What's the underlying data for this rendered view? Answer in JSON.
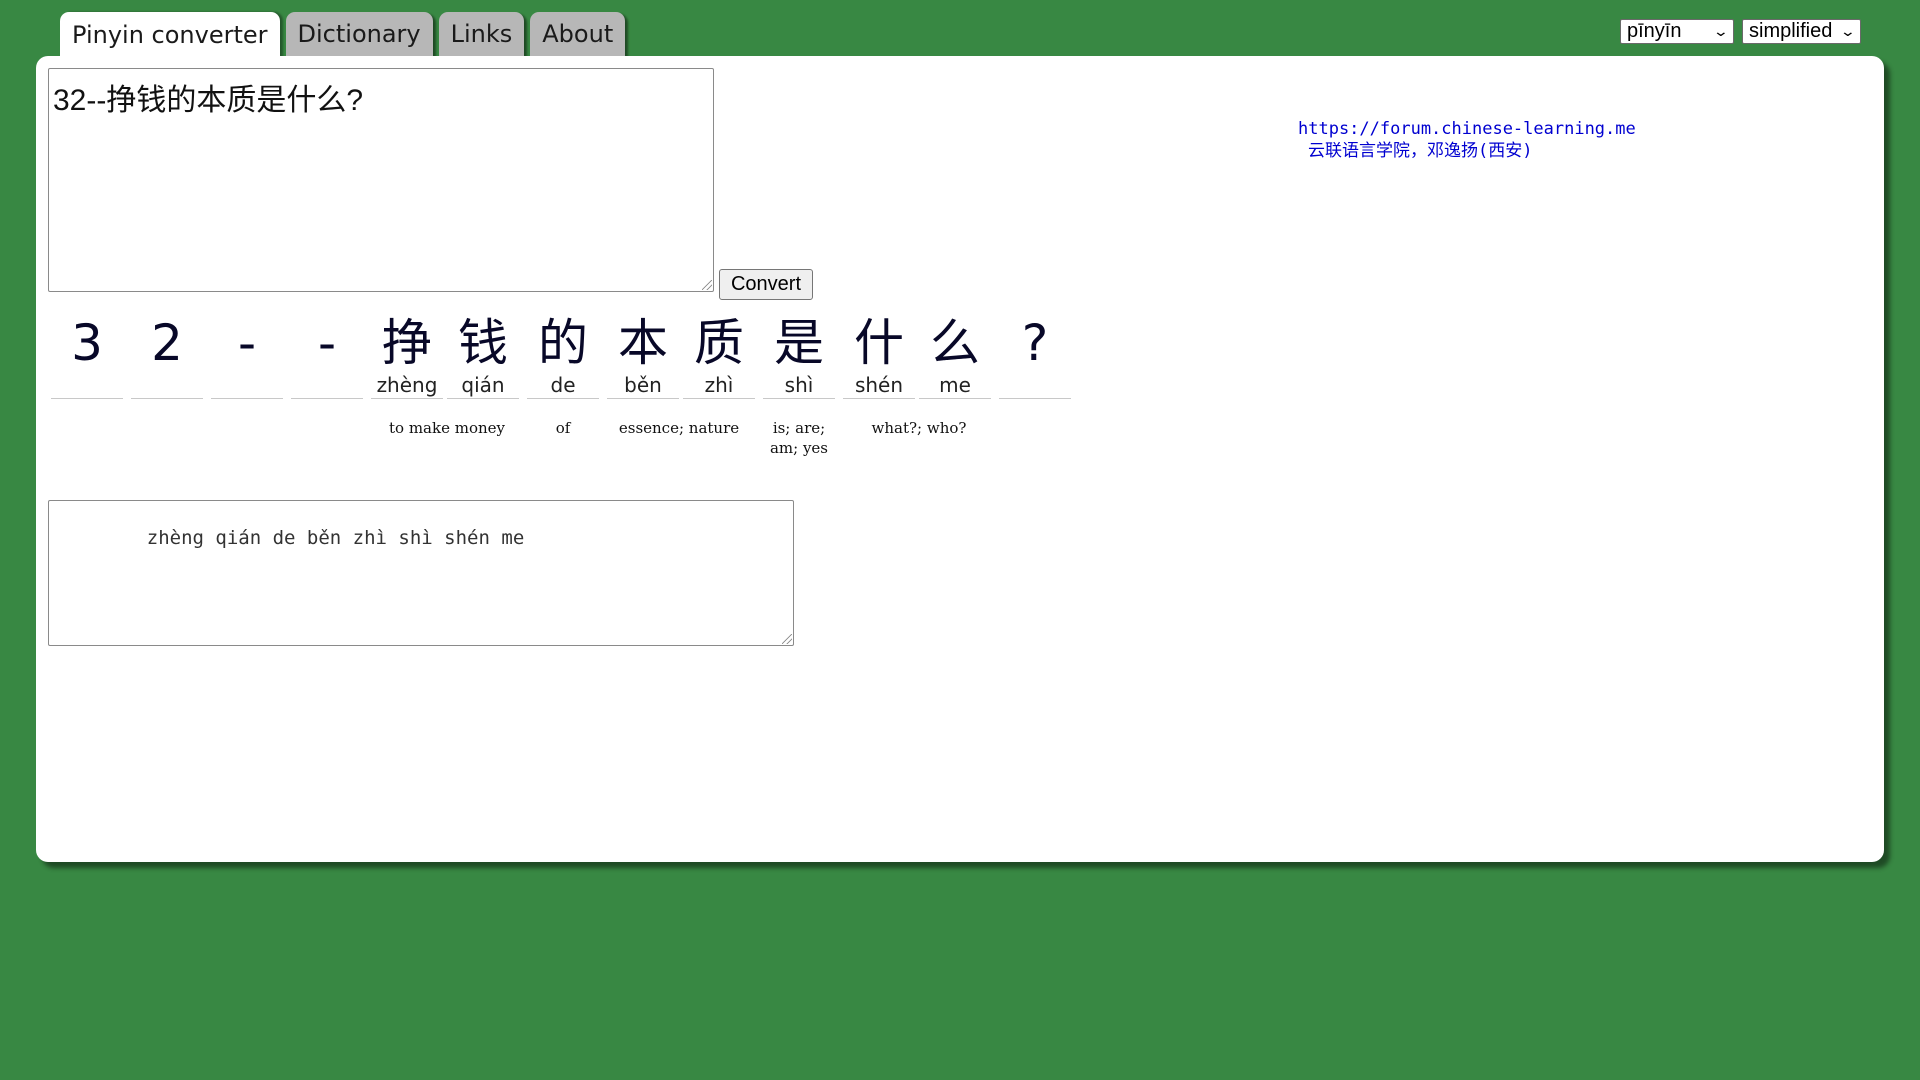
{
  "tabs": [
    "Pinyin converter",
    "Dictionary",
    "Links",
    "About"
  ],
  "active_tab": 0,
  "selects": {
    "romanization": "pīnyīn",
    "script": "simplified"
  },
  "input": {
    "value": "32--挣钱的本质是什么?"
  },
  "convert_label": "Convert",
  "credit": {
    "url": "https://forum.chinese-learning.me",
    "author": "云联语言学院，邓逸扬(西安)"
  },
  "syllables": [
    {
      "hanzi": "3",
      "pinyin": ""
    },
    {
      "hanzi": "2",
      "pinyin": ""
    },
    {
      "hanzi": "-",
      "pinyin": ""
    },
    {
      "hanzi": "-",
      "pinyin": ""
    },
    {
      "hanzi": "挣",
      "pinyin": "zhèng"
    },
    {
      "hanzi": "钱",
      "pinyin": "qián"
    },
    {
      "hanzi": "的",
      "pinyin": "de"
    },
    {
      "hanzi": "本",
      "pinyin": "běn"
    },
    {
      "hanzi": "质",
      "pinyin": "zhì"
    },
    {
      "hanzi": "是",
      "pinyin": "shì"
    },
    {
      "hanzi": "什",
      "pinyin": "shén"
    },
    {
      "hanzi": "么",
      "pinyin": "me"
    },
    {
      "hanzi": "?",
      "pinyin": ""
    }
  ],
  "glosses": [
    {
      "text": "to make money"
    },
    {
      "text": "of"
    },
    {
      "text": "essence; nature"
    },
    {
      "text": "is; are;\nam; yes"
    },
    {
      "text": "what?; who?"
    }
  ],
  "output": {
    "value": "zhèng qián de běn zhì shì shén me"
  }
}
